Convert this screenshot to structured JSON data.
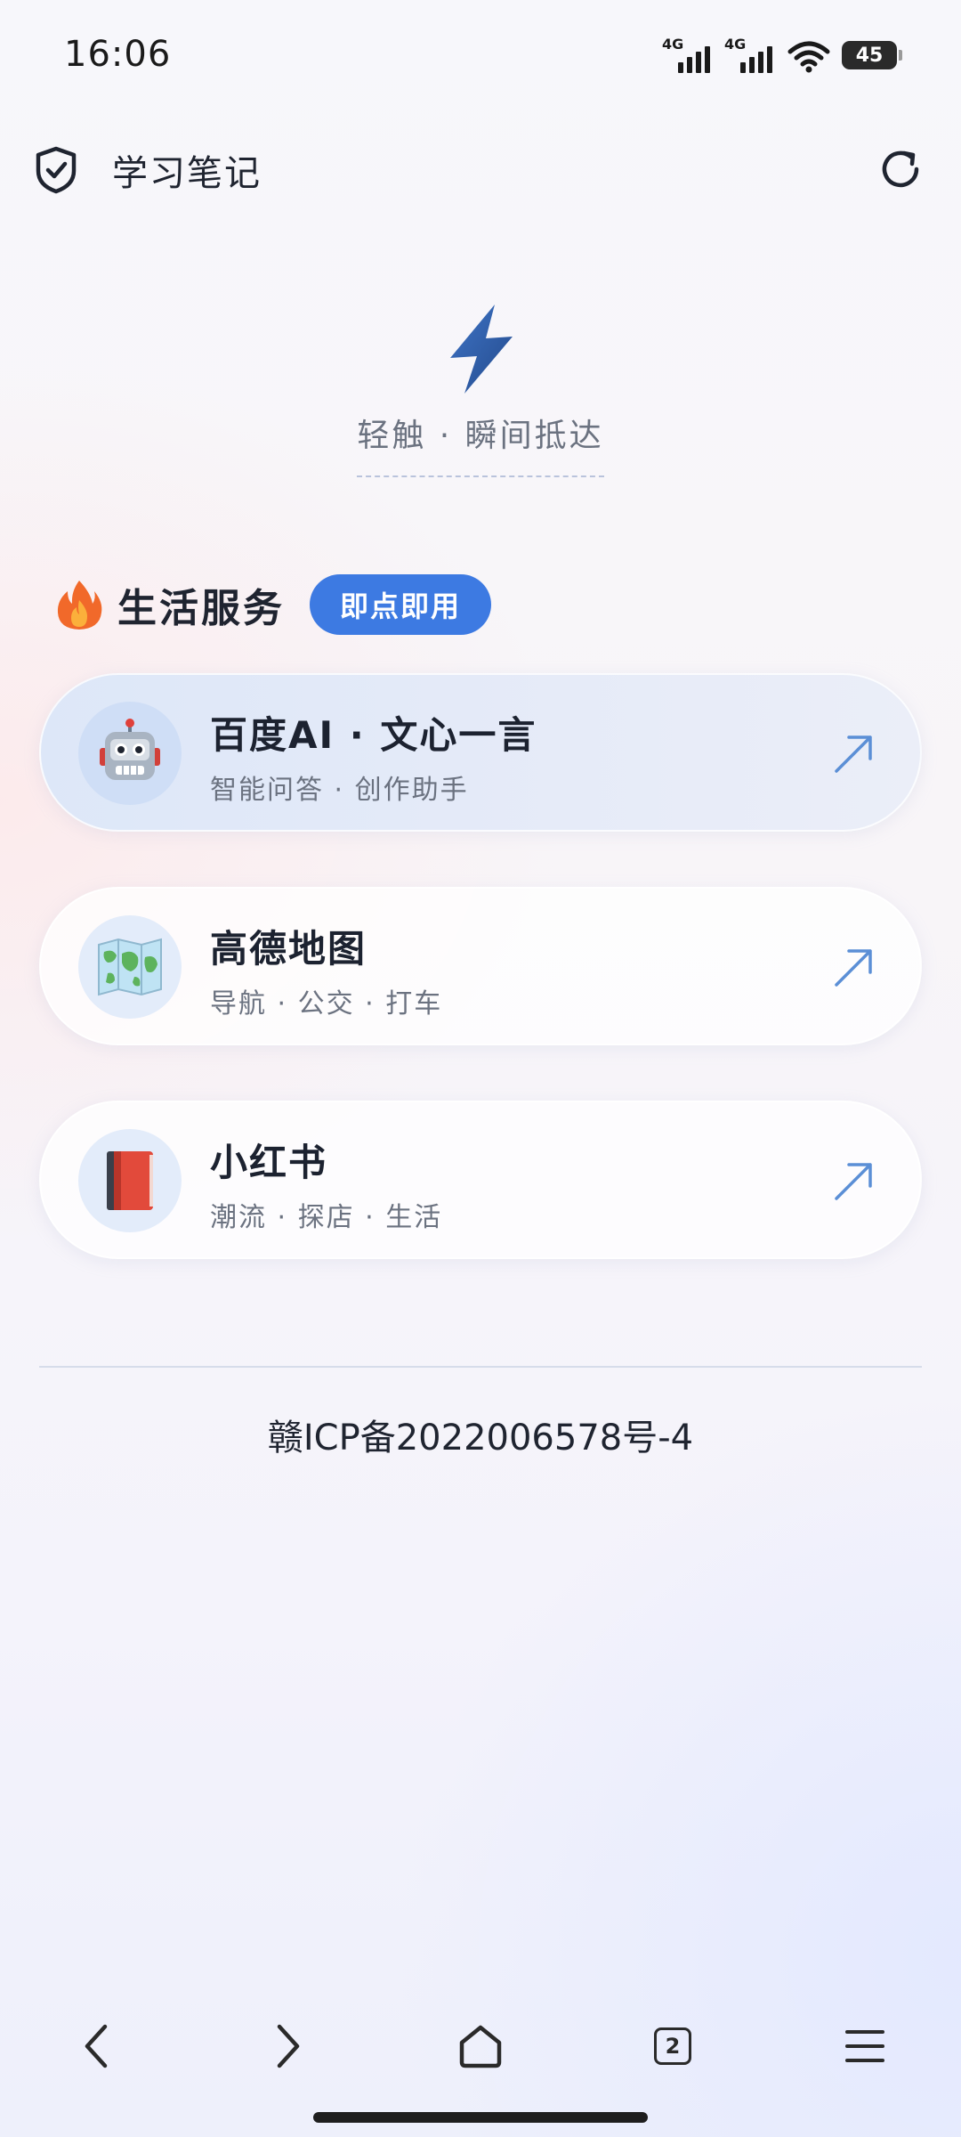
{
  "status_bar": {
    "time": "16:06",
    "network_1": "4G",
    "network_2": "4G",
    "battery": "45",
    "icons": [
      "signal-icon",
      "signal-icon",
      "wifi-icon",
      "battery-icon"
    ]
  },
  "header": {
    "title": "学习笔记",
    "left_icon": "shield-check-icon",
    "right_icon": "refresh-icon"
  },
  "hero": {
    "icon": "lightning-bolt-icon",
    "tagline": "轻触 · 瞬间抵达"
  },
  "section": {
    "icon": "fire-icon",
    "title": "生活服务",
    "badge": "即点即用"
  },
  "services": [
    {
      "title": "百度AI · 文心一言",
      "subtitle": "智能问答 · 创作助手",
      "icon": "robot-icon",
      "active": true
    },
    {
      "title": "高德地图",
      "subtitle": "导航 · 公交 · 打车",
      "icon": "world-map-icon",
      "active": false
    },
    {
      "title": "小红书",
      "subtitle": "潮流 · 探店 · 生活",
      "icon": "red-book-icon",
      "active": false
    }
  ],
  "footer": {
    "icp": "赣ICP备2022006578号-4"
  },
  "bottom_nav": {
    "tab_count": "2",
    "icons": [
      "back-icon",
      "forward-icon",
      "home-icon",
      "tabs-icon",
      "menu-icon"
    ]
  },
  "colors": {
    "accent": "#3d7ae2",
    "bolt": "#2f5fae",
    "arrow": "#5b8fd6",
    "text_primary": "#1f2430",
    "text_secondary": "#6b7280"
  }
}
